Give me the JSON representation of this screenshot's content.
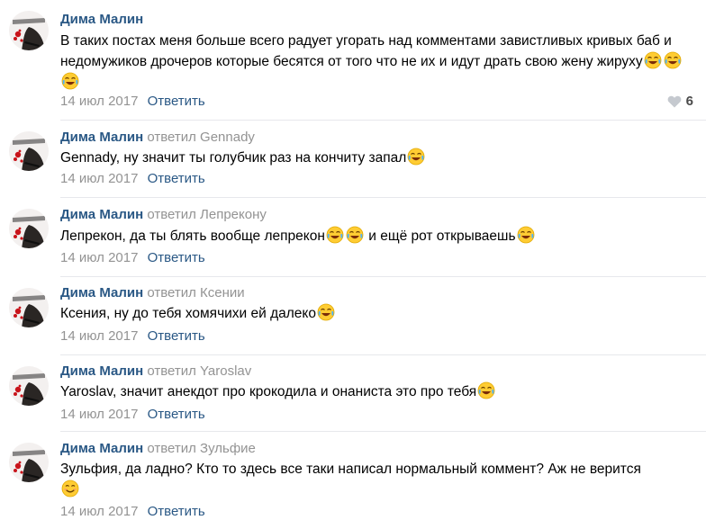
{
  "colors": {
    "link": "#2a5885",
    "muted": "#939393",
    "divider": "#e7e8ec"
  },
  "comments": [
    {
      "author": "Дима Малин",
      "reply_word": "",
      "reply_to": "",
      "text_parts": [
        "В таких постах меня больше всего радует угорать над комментами завистливых кривых баб и недомужиков дрочеров которые бесятся от того что не их и идут драть свою жену жируху"
      ],
      "date": "14 июл 2017",
      "reply_label": "Ответить",
      "likes": "6"
    },
    {
      "author": "Дима Малин",
      "reply_word": "ответил",
      "reply_to": "Gennady",
      "text_parts": [
        "Gennady, ну значит ты голубчик раз на кончиту запал"
      ],
      "date": "14 июл 2017",
      "reply_label": "Ответить"
    },
    {
      "author": "Дима Малин",
      "reply_word": "ответил",
      "reply_to": "Лепрекону",
      "text_parts": [
        "Лепрекон, да ты блять вообще лепрекон",
        "и ещё рот открываешь"
      ],
      "date": "14 июл 2017",
      "reply_label": "Ответить"
    },
    {
      "author": "Дима Малин",
      "reply_word": "ответил",
      "reply_to": "Ксении",
      "text_parts": [
        "Ксения, ну до тебя хомячихи ей далеко"
      ],
      "date": "14 июл 2017",
      "reply_label": "Ответить"
    },
    {
      "author": "Дима Малин",
      "reply_word": "ответил",
      "reply_to": "Yaroslav",
      "text_parts": [
        "Yaroslav, значит анекдот про крокодила и онаниста это про тебя"
      ],
      "date": "14 июл 2017",
      "reply_label": "Ответить"
    },
    {
      "author": "Дима Малин",
      "reply_word": "ответил",
      "reply_to": "Зульфие",
      "text_parts": [
        "Зульфия, да ладно? Кто то здесь все таки написал нормальный коммент? Аж не верится"
      ],
      "date": "14 июл 2017",
      "reply_label": "Ответить"
    }
  ]
}
